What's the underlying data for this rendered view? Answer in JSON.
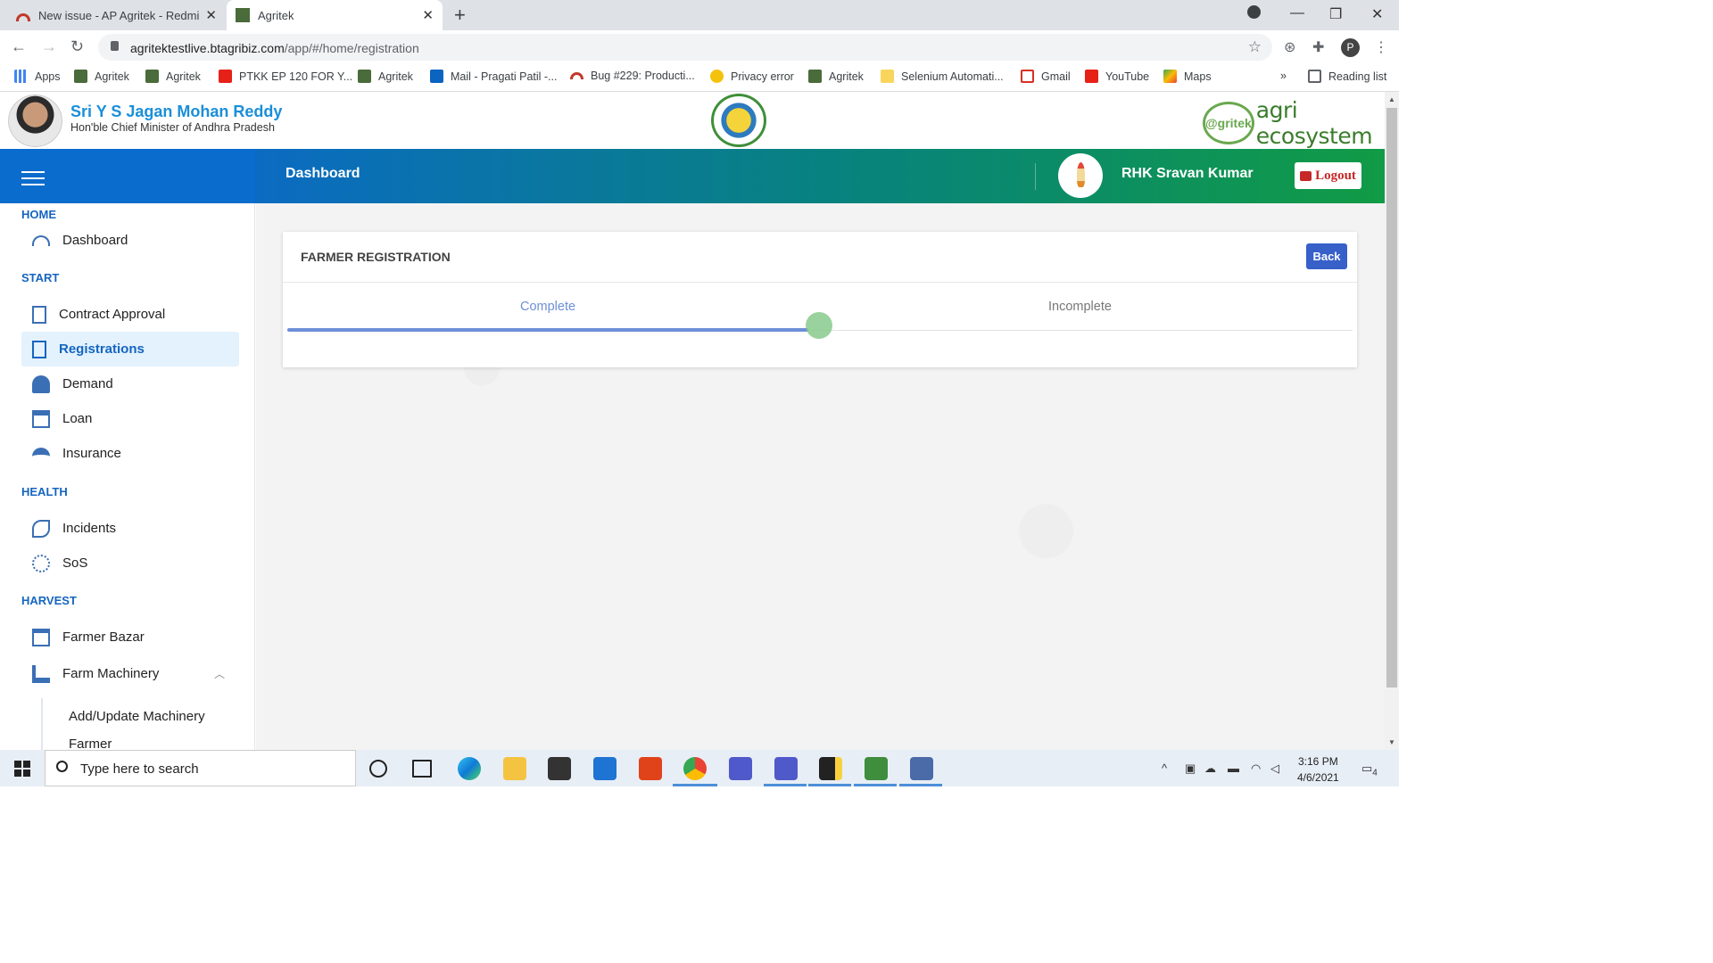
{
  "browser": {
    "tabs": [
      {
        "title": "New issue - AP Agritek - Redmin",
        "active": false
      },
      {
        "title": "Agritek",
        "active": true
      }
    ],
    "url_host": "agritektestlive.btagribiz.com",
    "url_path": "/app/#/home/registration",
    "bookmarks": [
      "Apps",
      "Agritek",
      "Agritek",
      "PTKK EP 120 FOR Y...",
      "Agritek",
      "Mail - Pragati Patil -...",
      "Bug #229: Producti...",
      "Privacy error",
      "Agritek",
      "Selenium Automati...",
      "Gmail",
      "YouTube",
      "Maps"
    ],
    "reading_list": "Reading list",
    "overflow": "»",
    "profile_initial": "P"
  },
  "header": {
    "cm_name": "Sri Y S Jagan Mohan Reddy",
    "cm_role": "Hon'ble Chief Minister of Andhra Pradesh",
    "brand_logo": "@gritek",
    "brand_text": "agri ecosystem"
  },
  "topbar": {
    "title": "Dashboard",
    "user_name": "RHK Sravan Kumar",
    "logout_label": "Logout"
  },
  "sidebar": {
    "sections": {
      "home": "HOME",
      "start": "START",
      "health": "HEALTH",
      "harvest": "HARVEST"
    },
    "items": {
      "dashboard": "Dashboard",
      "contract_approval": "Contract Approval",
      "registrations": "Registrations",
      "demand": "Demand",
      "loan": "Loan",
      "insurance": "Insurance",
      "incidents": "Incidents",
      "sos": "SoS",
      "farmer_bazar": "Farmer Bazar",
      "farm_machinery": "Farm Machinery"
    },
    "subitems": {
      "add_update_machinery": "Add/Update Machinery",
      "farmer": "Farmer"
    }
  },
  "main": {
    "card_title": "FARMER REGISTRATION",
    "back_label": "Back",
    "tabs": [
      "Complete",
      "Incomplete"
    ],
    "selected_tab": "Complete"
  },
  "taskbar": {
    "search_placeholder": "Type here to search",
    "time": "3:16 PM",
    "date": "4/6/2021",
    "notification_count": "4"
  },
  "colors": {
    "primary": "#0a6ccc",
    "accent_green": "#119b45",
    "active_tab": "#6e8fd8",
    "logout_red": "#c62828",
    "back_blue": "#3760c9"
  }
}
